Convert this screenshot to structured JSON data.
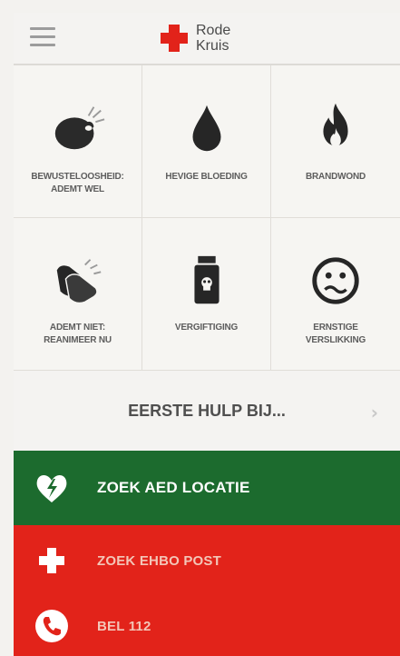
{
  "header": {
    "brand_line1": "Rode",
    "brand_line2": "Kruis",
    "menu_icon": "hamburger-menu-icon",
    "logo_icon": "red-cross-icon"
  },
  "categories": [
    {
      "label": "BEWUSTELOOSHEID:\nADEMT WEL",
      "icon": "unconscious-head-icon"
    },
    {
      "label": "HEVIGE BLOEDING",
      "icon": "blood-drop-icon"
    },
    {
      "label": "BRANDWOND",
      "icon": "flame-icon"
    },
    {
      "label": "ADEMT NIET:\nREANIMEER NU",
      "icon": "cpr-hands-icon"
    },
    {
      "label": "VERGIFTIGING",
      "icon": "poison-bottle-icon"
    },
    {
      "label": "ERNSTIGE\nVERSLIKKING",
      "icon": "choking-face-icon"
    }
  ],
  "first_aid": {
    "label": "EERSTE HULP BIJ...",
    "icon": "chevron-right-icon"
  },
  "actions": {
    "aed": {
      "label": "ZOEK AED LOCATIE",
      "icon": "heart-defibrillator-icon"
    },
    "ehbo": {
      "label": "ZOEK EHBO POST",
      "icon": "plus-cross-icon"
    },
    "call": {
      "label": "BEL 112",
      "icon": "phone-icon"
    }
  },
  "colors": {
    "brand_red": "#e2231a",
    "aed_green": "#1c6b2e",
    "background": "#f3f2ef"
  }
}
